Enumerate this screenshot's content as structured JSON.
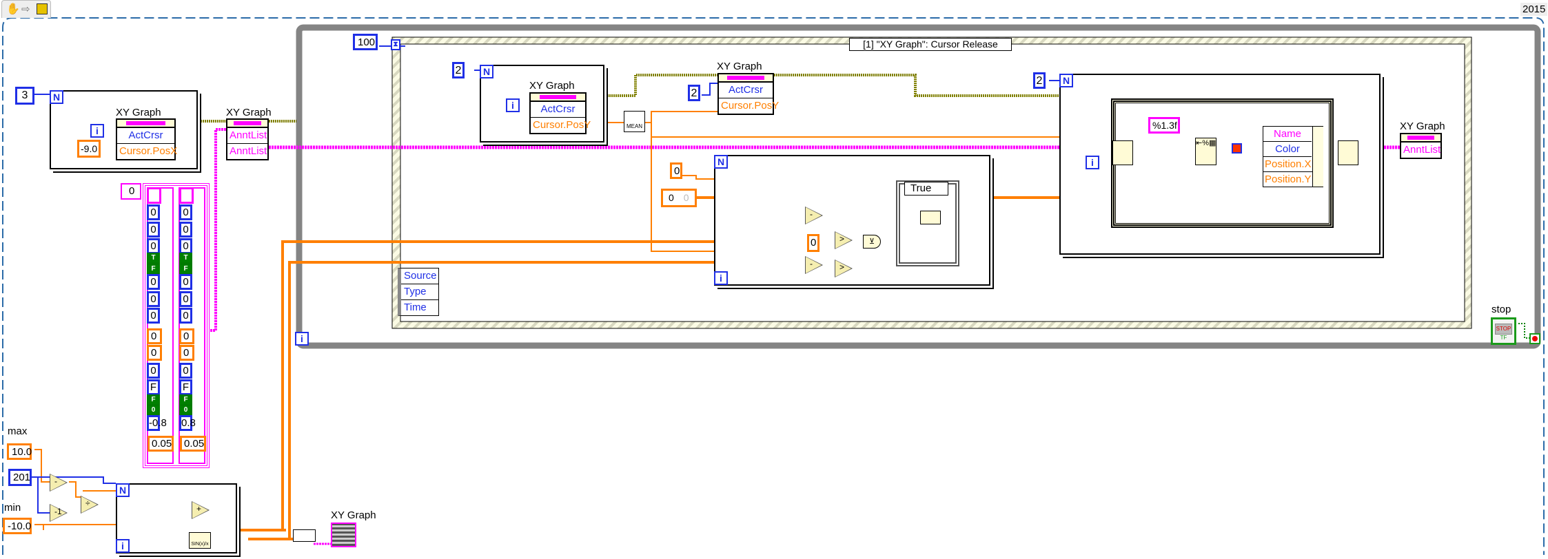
{
  "toolbar": {
    "icons": [
      "hand-tool-icon",
      "arrow-tool-icon",
      "vi-icon"
    ]
  },
  "version_label": "2015",
  "outer_loop": {
    "wait_ms": "100"
  },
  "event_structure": {
    "selector": "[1] \"XY Graph\": Cursor Release",
    "event_data": [
      "Source",
      "Type",
      "Time"
    ]
  },
  "init_loop": {
    "count": "3",
    "node": {
      "label": "XY Graph",
      "rows": [
        "ActCrsr",
        "Cursor.PosX"
      ]
    },
    "posx_const": "-9.0",
    "index": "i",
    "n": "N"
  },
  "annt_node": {
    "label": "XY Graph",
    "rows": [
      "AnntList",
      "AnntList"
    ]
  },
  "annotation_array": {
    "index": "0",
    "left": [
      "0",
      "0",
      "0",
      "T",
      "F",
      "0",
      "0",
      "0",
      "0",
      "0",
      "0",
      "F",
      "F",
      "0",
      "-0.8",
      "0.05"
    ],
    "right": [
      "0",
      "0",
      "0",
      "T",
      "F",
      "0",
      "0",
      "0",
      "0",
      "0",
      "0",
      "F",
      "F",
      "0",
      "0.8",
      "0.05"
    ]
  },
  "generator": {
    "max_label": "max",
    "max_value": "10.0",
    "count": "201",
    "min_label": "min",
    "min_value": "-10.0",
    "ops": [
      "-",
      "-1",
      "÷",
      "+"
    ],
    "sinc_label": "SIN(x)/x",
    "graph_label": "XY Graph"
  },
  "cursor_loop": {
    "count": "2",
    "node": {
      "label": "XY Graph",
      "rows": [
        "ActCrsr",
        "Cursor.PosY"
      ]
    },
    "mean_label": "MEAN"
  },
  "cursor_node2": {
    "label": "XY Graph",
    "rows": [
      "ActCrsr",
      "Cursor.PosY"
    ],
    "const": "2"
  },
  "search_loop": {
    "init_const": "0",
    "array_index": "0",
    "array_value": "0",
    "zero_const": "0",
    "case_label": "True",
    "ops": [
      "-",
      "-",
      ">",
      ">"
    ]
  },
  "annt_loop": {
    "count": "2",
    "format": "%1.3f",
    "bundle_rows": [
      "Name",
      "Color",
      "Position.X",
      "Position.Y"
    ],
    "color_value": "#ff3300"
  },
  "annt_out": {
    "label": "XY Graph",
    "row": "AnntList"
  },
  "stop": {
    "label": "stop",
    "button_text": "STOP",
    "tf": "TF"
  },
  "colors": {
    "numeric_wire": "#ff7f00",
    "int_wire": "#1f2fe6",
    "cluster_wire": "#ff00ff",
    "refnum_wire": "#808000",
    "loop_frame": "#808080"
  }
}
